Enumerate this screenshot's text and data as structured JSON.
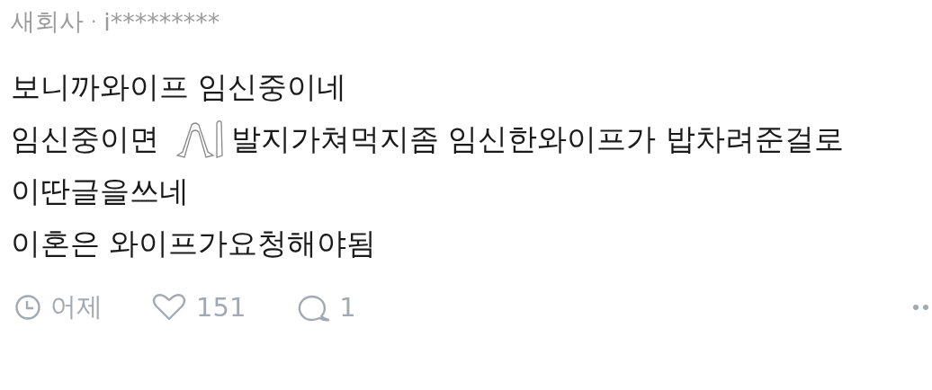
{
  "header": {
    "company": "새회사",
    "separator": "·",
    "author": "i*********"
  },
  "body": [
    {
      "parts": [
        {
          "kind": "text",
          "text": "보니까와이프 임신중이네"
        }
      ]
    },
    {
      "parts": [
        {
          "kind": "text",
          "text": "임신중이면"
        },
        {
          "kind": "emoji"
        },
        {
          "kind": "text",
          "text": "발지가쳐먹지좀 임신한와이프가 밥차려준걸로"
        }
      ]
    },
    {
      "parts": [
        {
          "kind": "text",
          "text": "이딴글을쓰네"
        }
      ]
    },
    {
      "parts": [
        {
          "kind": "text",
          "text": "이혼은 와이프가요청해야됨"
        }
      ]
    }
  ],
  "footer": {
    "time": "어제",
    "likes": "151",
    "comments": "1"
  }
}
